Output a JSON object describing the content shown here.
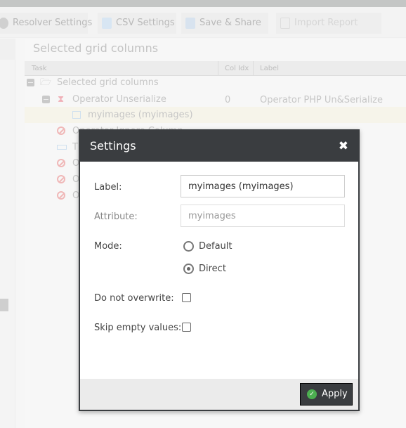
{
  "toolbar": {
    "items": [
      {
        "label": "Resolver Settings",
        "icon": "gear-icon"
      },
      {
        "label": "CSV Settings",
        "icon": "wrench-file-icon"
      },
      {
        "label": "Save & Share",
        "icon": "users-icon"
      },
      {
        "label": "Import Report",
        "icon": "clipboard-check-icon"
      }
    ]
  },
  "panel": {
    "title": "Selected grid columns",
    "columns": [
      "Task",
      "Col Idx",
      "Label"
    ],
    "rows": [
      {
        "task": "Selected grid columns",
        "col": "",
        "label": ""
      },
      {
        "task": "Operator Unserialize",
        "col": "0",
        "label": "Operator PHP Un&Serialize"
      },
      {
        "task": "myimages (myimages)",
        "col": "",
        "label": ""
      },
      {
        "task": "Operator Ignore Column",
        "col": "",
        "label": ""
      },
      {
        "task": "T",
        "col": "",
        "label": ""
      },
      {
        "task": "O",
        "col": "",
        "label": ""
      },
      {
        "task": "O",
        "col": "",
        "label": ""
      },
      {
        "task": "O",
        "col": "",
        "label": ""
      }
    ]
  },
  "dialog": {
    "title": "Settings",
    "close": "✖",
    "label_label": "Label:",
    "label_value": "myimages (myimages)",
    "attribute_label": "Attribute:",
    "attribute_value": "myimages",
    "mode_label": "Mode:",
    "mode_options": [
      "Default",
      "Direct"
    ],
    "mode_selected": "Direct",
    "overwrite_label": "Do not overwrite:",
    "overwrite_checked": false,
    "skip_label": "Skip empty values:",
    "skip_checked": false,
    "apply": "Apply",
    "apply_icon": "✓"
  }
}
